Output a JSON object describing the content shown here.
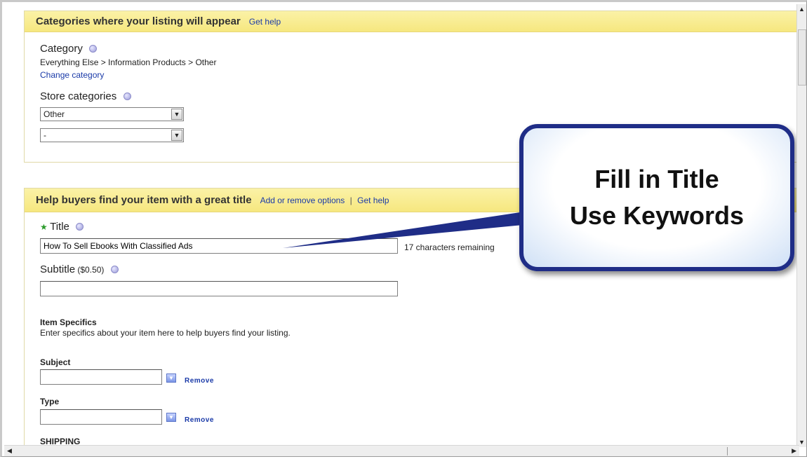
{
  "categories_section": {
    "title": "Categories where your listing will appear",
    "get_help": "Get help",
    "category_label": "Category",
    "category_path": "Everything Else > Information Products > Other",
    "change_category": "Change category",
    "store_categories_label": "Store categories",
    "store_category_1": "Other",
    "store_category_2": "-"
  },
  "title_section": {
    "title": "Help buyers find your item with a great title",
    "add_remove_options": "Add or remove options",
    "separator": "|",
    "get_help": "Get help",
    "required_star": "★",
    "title_label": "Title",
    "title_value": "How To Sell Ebooks With Classified Ads",
    "chars_remaining": "17 characters remaining",
    "subtitle_label": "Subtitle",
    "subtitle_price": "($0.50)",
    "subtitle_value": ""
  },
  "item_specifics": {
    "heading": "Item Specifics",
    "description": "Enter specifics about your item here to help buyers find your listing.",
    "fields": [
      {
        "label": "Subject",
        "value": "",
        "remove": "Remove"
      },
      {
        "label": "Type",
        "value": "",
        "remove": "Remove"
      }
    ],
    "shipping_heading": "SHIPPING"
  },
  "callout": {
    "line1": "Fill in Title",
    "line2": "Use Keywords"
  },
  "colors": {
    "section_header": "#f6e77f",
    "link": "#1a3aa8",
    "callout_border": "#1f2d87"
  }
}
